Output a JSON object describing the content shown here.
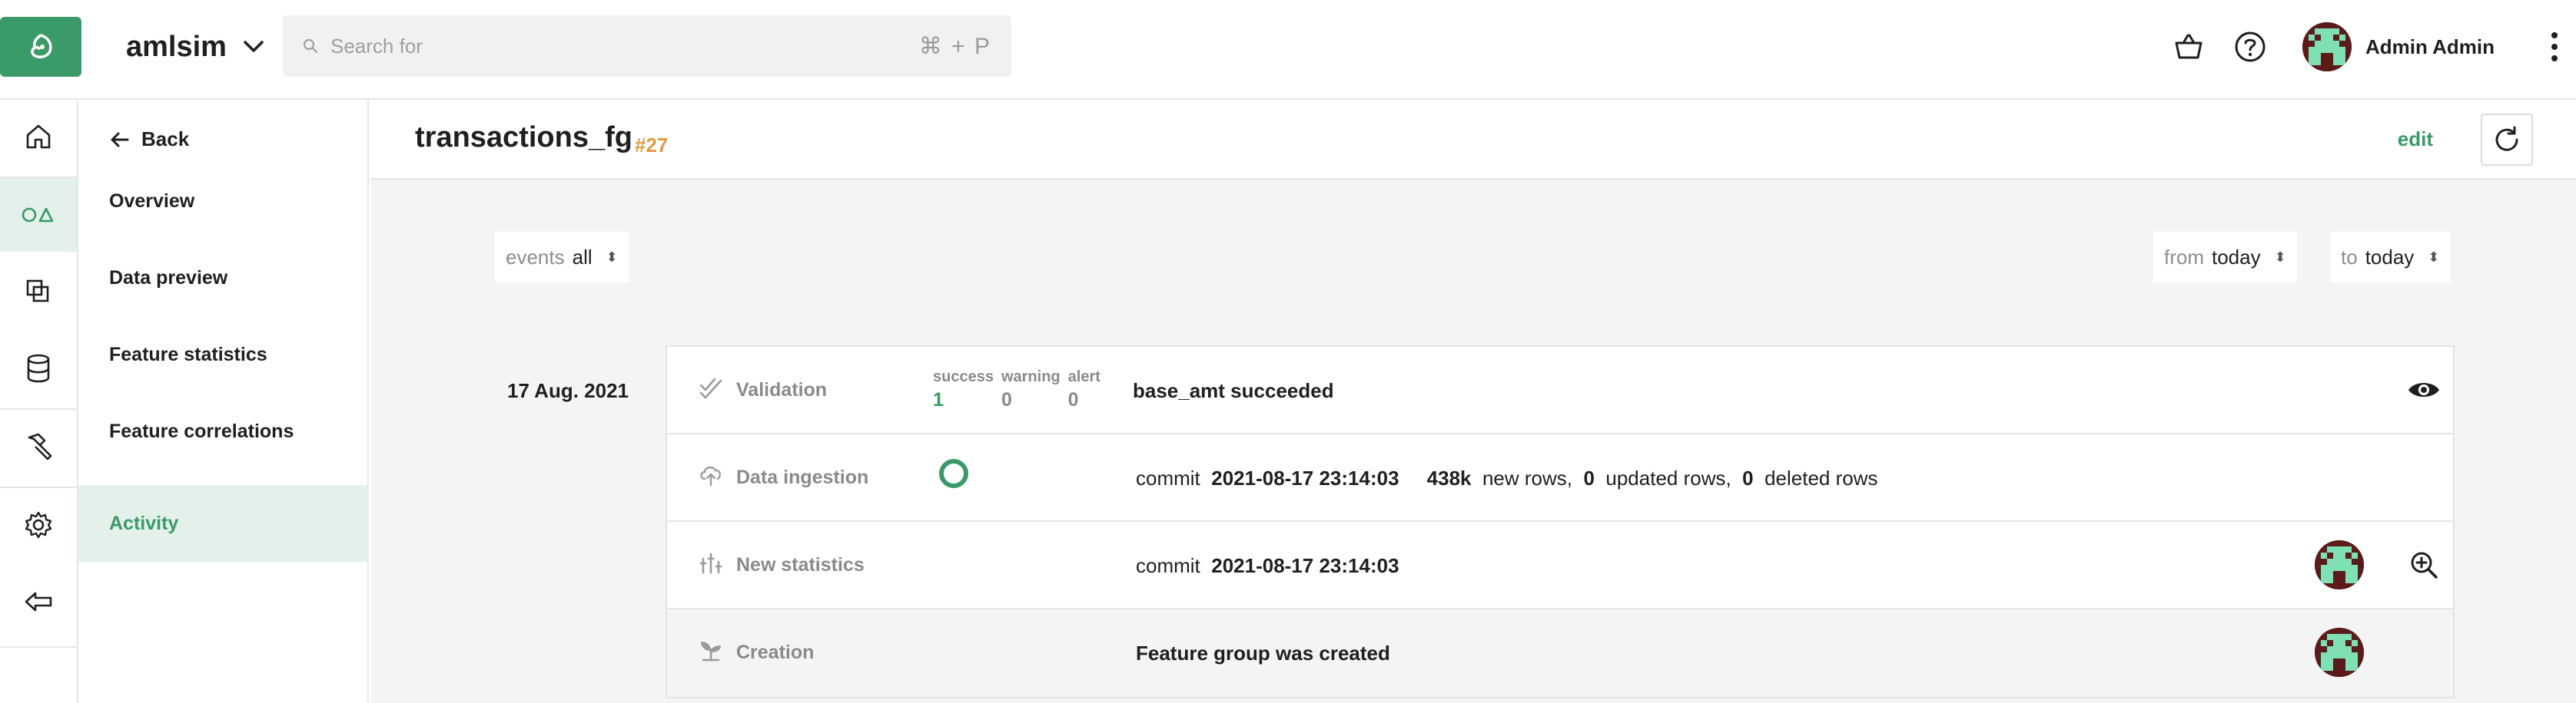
{
  "header": {
    "project_name": "amlsim",
    "search_placeholder": "Search for",
    "search_shortcut": "⌘ + P",
    "user_name": "Admin Admin"
  },
  "subnav": {
    "back_label": "Back",
    "items": [
      {
        "label": "Overview",
        "active": false
      },
      {
        "label": "Data preview",
        "active": false
      },
      {
        "label": "Feature statistics",
        "active": false
      },
      {
        "label": "Feature correlations",
        "active": false
      },
      {
        "label": "Activity",
        "active": true
      }
    ]
  },
  "page": {
    "title": "transactions_fg",
    "version": "#27",
    "edit_label": "edit"
  },
  "filters": {
    "events_label": "events",
    "events_value": "all",
    "from_label": "from",
    "from_value": "today",
    "to_label": "to",
    "to_value": "today"
  },
  "activity": {
    "date": "17 Aug. 2021",
    "events": [
      {
        "type": "Validation",
        "stats": [
          {
            "key": "success",
            "value": "1"
          },
          {
            "key": "warning",
            "value": "0"
          },
          {
            "key": "alert",
            "value": "0"
          }
        ],
        "message": "base_amt succeeded"
      },
      {
        "type": "Data ingestion",
        "commit_label": "commit",
        "commit_time": "2021-08-17 23:14:03",
        "new_rows": "438k",
        "new_rows_label": "new rows,",
        "updated_rows": "0",
        "updated_rows_label": "updated rows,",
        "deleted_rows": "0",
        "deleted_rows_label": "deleted rows"
      },
      {
        "type": "New statistics",
        "commit_label": "commit",
        "commit_time": "2021-08-17 23:14:03"
      },
      {
        "type": "Creation",
        "message": "Feature group was created"
      }
    ]
  },
  "colors": {
    "accent": "#3a9a68",
    "version": "#e39a42",
    "active_bg": "#e4f1ea"
  }
}
